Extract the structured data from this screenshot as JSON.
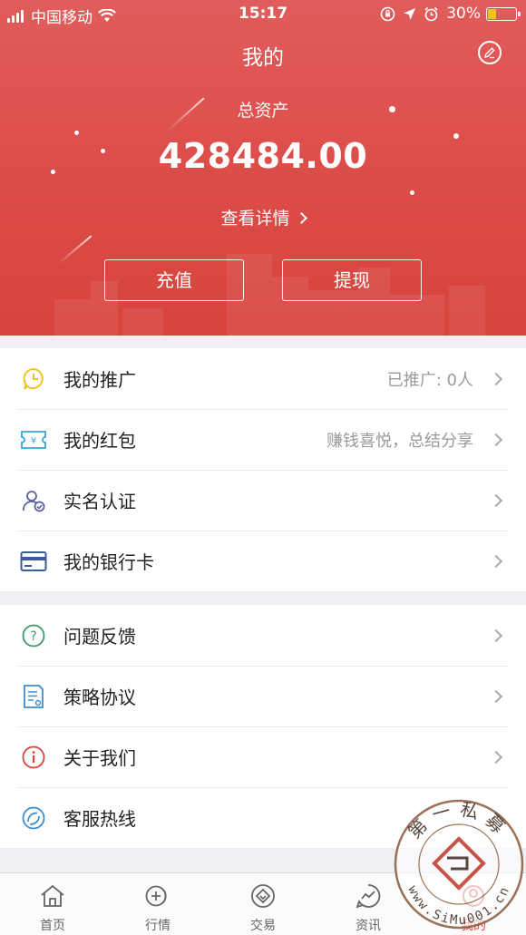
{
  "status_bar": {
    "carrier": "中国移动",
    "time": "15:17",
    "battery_percent": "30%",
    "battery_level": 0.3,
    "battery_color": "#f4c21e",
    "icons": [
      "signal-icon",
      "wifi-icon",
      "orientation-lock-icon",
      "location-icon",
      "alarm-icon",
      "battery-icon"
    ]
  },
  "header": {
    "title": "我的",
    "edit_icon": "edit-icon"
  },
  "assets": {
    "label": "总资产",
    "value": "428484.00",
    "details_label": "查看详情"
  },
  "actions": {
    "recharge": "充值",
    "withdraw": "提现"
  },
  "menu_groups": [
    [
      {
        "label": "我的推广",
        "value": "已推广: 0人",
        "icon": "promotion-icon",
        "color": "#f0c419"
      },
      {
        "label": "我的红包",
        "value": "赚钱喜悦，总结分享",
        "icon": "red-packet-icon",
        "color": "#38a6d9"
      },
      {
        "label": "实名认证",
        "value": "",
        "icon": "identity-icon",
        "color": "#5a5fa8"
      },
      {
        "label": "我的银行卡",
        "value": "",
        "icon": "bank-card-icon",
        "color": "#3a5c9a"
      }
    ],
    [
      {
        "label": "问题反馈",
        "value": "",
        "icon": "question-icon",
        "color": "#3d9b6b"
      },
      {
        "label": "策略协议",
        "value": "",
        "icon": "document-icon",
        "color": "#3b8fd0"
      },
      {
        "label": "关于我们",
        "value": "",
        "icon": "info-icon",
        "color": "#d9453b"
      },
      {
        "label": "客服热线",
        "value": "",
        "icon": "phone-icon",
        "color": "#3b8fd0"
      }
    ]
  ],
  "tabbar": [
    {
      "label": "首页",
      "icon": "home-icon",
      "active": false
    },
    {
      "label": "行情",
      "icon": "market-icon",
      "active": false
    },
    {
      "label": "交易",
      "icon": "trade-icon",
      "active": false
    },
    {
      "label": "资讯",
      "icon": "news-icon",
      "active": false
    },
    {
      "label": "我的",
      "icon": "profile-icon",
      "active": true
    }
  ],
  "watermark": {
    "top_text": "第一私募",
    "bottom_text": "www.SiMu001.cn"
  },
  "colors": {
    "accent": "#e0473f",
    "hero_top": "#e15c5c",
    "hero_bottom": "#d8433d"
  }
}
